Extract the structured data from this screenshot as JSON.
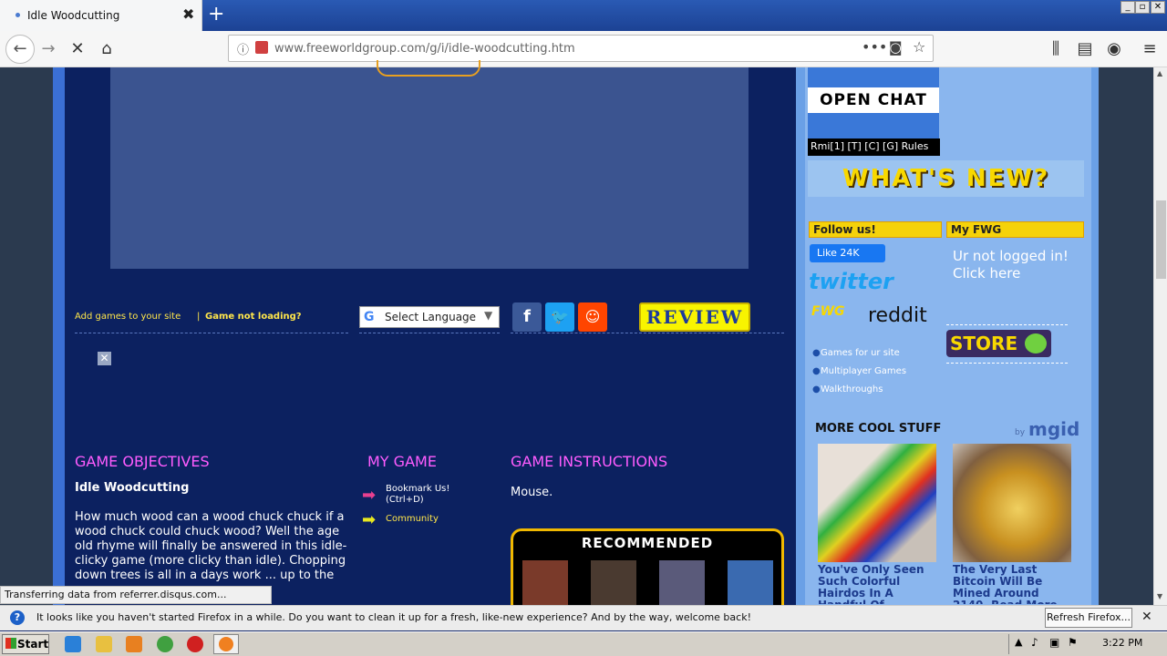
{
  "browser": {
    "tab_title": "Idle Woodcutting",
    "tab_close": "✖",
    "new_tab": "+",
    "url": "www.freeworldgroup.com/g/i/idle-woodcutting.htm",
    "window_controls": [
      "_",
      "▫",
      "✕"
    ]
  },
  "page": {
    "add_games": "Add games to your site",
    "separator": "|",
    "game_not_loading": "Game not loading?",
    "select_language": "Select Language",
    "review": "REVIEW",
    "objectives": {
      "heading": "GAME OBJECTIVES",
      "title": "Idle Woodcutting",
      "text": "How much wood can a wood chuck chuck if a wood chuck could chuck wood? Well the age old rhyme will finally be answered in this idle-clicky game (more clicky than idle). Chopping down trees is all in a days work ... up to the ..."
    },
    "my_game": {
      "heading": "MY GAME",
      "bookmark": "Bookmark Us! (Ctrl+D)",
      "community": "Community"
    },
    "instructions": {
      "heading": "GAME INSTRUCTIONS",
      "text": "Mouse."
    },
    "recommended": "RECOMMENDED"
  },
  "sidebar": {
    "open_chat": "OPEN CHAT",
    "chat_links": "Rmi[1] [T] [C] [G] Rules",
    "whats_new": "WHAT'S NEW?",
    "follow_us": "Follow us!",
    "my_fwg": "My FWG",
    "fb_like": "Like 24K",
    "twitter": "twitter",
    "fwg": "FWG",
    "reddit": "reddit",
    "login_line1": "Ur not logged in!",
    "login_line2": "Click here",
    "store": "STORE",
    "links": [
      "Games for ur site",
      "Multiplayer Games",
      "Walkthroughs"
    ],
    "more_cool": "MORE COOL STUFF",
    "mgid": "mgid",
    "by": "by",
    "ad1": "You've Only Seen Such Colorful Hairdos In A Handful Of",
    "ad2": "The Very Last Bitcoin Will Be Mined Around 2140. Read More"
  },
  "status": "Transferring data from referrer.disqus.com...",
  "notification": {
    "text": "It looks like you haven't started Firefox in a while. Do you want to clean it up for a fresh, like-new experience? And by the way, welcome back!",
    "button": "Refresh Firefox...",
    "close": "✕"
  },
  "taskbar": {
    "start": "Start",
    "time": "3:22 PM"
  },
  "colors": {
    "page_bg": "#0c2160",
    "sidebar_bg": "#8ab6ee",
    "accent_magenta": "#ff5cff",
    "accent_yellow": "#ffe64a"
  }
}
